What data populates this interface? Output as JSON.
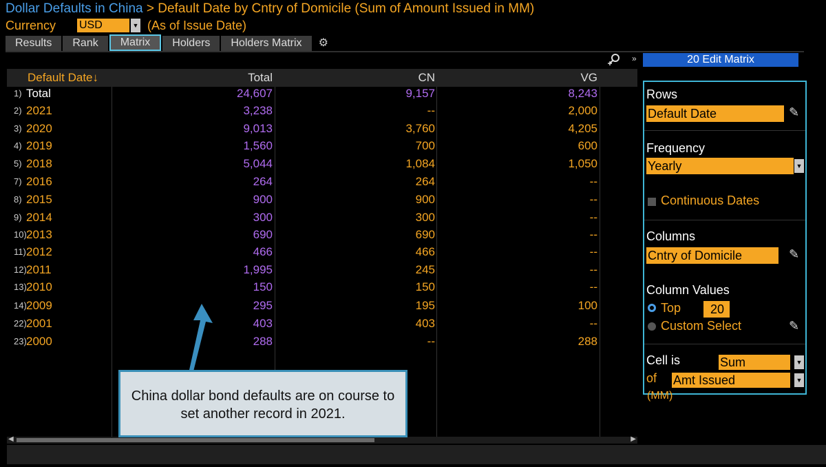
{
  "breadcrumb": {
    "link": "Dollar Defaults in China",
    "sep": ">",
    "title": "Default Date by Cntry of Domicile (Sum of Amount Issued in MM)"
  },
  "currency": {
    "label": "Currency",
    "value": "USD",
    "note": "(As of Issue Date)"
  },
  "tabs": [
    "Results",
    "Rank",
    "Matrix",
    "Holders",
    "Holders Matrix"
  ],
  "active_tab": "Matrix",
  "toolbar": {
    "edit_matrix": "20 Edit Matrix"
  },
  "table": {
    "headers": {
      "date": "Default Date",
      "total": "Total",
      "cn": "CN",
      "vg": "VG"
    },
    "rows": [
      {
        "num": "1)",
        "date": "Total",
        "total": "24,607",
        "cn": "9,157",
        "vg": "8,243"
      },
      {
        "num": "2)",
        "date": "2021",
        "total": "3,238",
        "cn": "--",
        "vg": "2,000"
      },
      {
        "num": "3)",
        "date": "2020",
        "total": "9,013",
        "cn": "3,760",
        "vg": "4,205"
      },
      {
        "num": "4)",
        "date": "2019",
        "total": "1,560",
        "cn": "700",
        "vg": "600"
      },
      {
        "num": "5)",
        "date": "2018",
        "total": "5,044",
        "cn": "1,084",
        "vg": "1,050"
      },
      {
        "num": "7)",
        "date": "2016",
        "total": "264",
        "cn": "264",
        "vg": "--"
      },
      {
        "num": "8)",
        "date": "2015",
        "total": "900",
        "cn": "900",
        "vg": "--"
      },
      {
        "num": "9)",
        "date": "2014",
        "total": "300",
        "cn": "300",
        "vg": "--"
      },
      {
        "num": "10)",
        "date": "2013",
        "total": "690",
        "cn": "690",
        "vg": "--"
      },
      {
        "num": "11)",
        "date": "2012",
        "total": "466",
        "cn": "466",
        "vg": "--"
      },
      {
        "num": "12)",
        "date": "2011",
        "total": "1,995",
        "cn": "245",
        "vg": "--"
      },
      {
        "num": "13)",
        "date": "2010",
        "total": "150",
        "cn": "150",
        "vg": "--"
      },
      {
        "num": "14)",
        "date": "2009",
        "total": "295",
        "cn": "195",
        "vg": "100"
      },
      {
        "num": "22)",
        "date": "2001",
        "total": "403",
        "cn": "403",
        "vg": "--"
      },
      {
        "num": "23)",
        "date": "2000",
        "total": "288",
        "cn": "--",
        "vg": "288"
      }
    ]
  },
  "panel": {
    "rows_label": "Rows",
    "rows_value": "Default Date",
    "frequency_label": "Frequency",
    "frequency_value": "Yearly",
    "continuous_dates": "Continuous Dates",
    "columns_label": "Columns",
    "columns_value": "Cntry of Domicile",
    "column_values_label": "Column Values",
    "top_label": "Top",
    "top_value": "20",
    "custom_select": "Custom Select",
    "cell_is_label": "Cell is",
    "cell_is_value": "Sum",
    "of_label": "of",
    "of_value": "Amt Issued",
    "unit": "(MM)"
  },
  "callout": {
    "text": "China dollar bond defaults are on course to set another record in 2021."
  },
  "colors": {
    "orange": "#f5a623",
    "purple": "#b06cf0",
    "blue_link": "#4a9ee8",
    "accent_cyan": "#3fb6d6"
  }
}
